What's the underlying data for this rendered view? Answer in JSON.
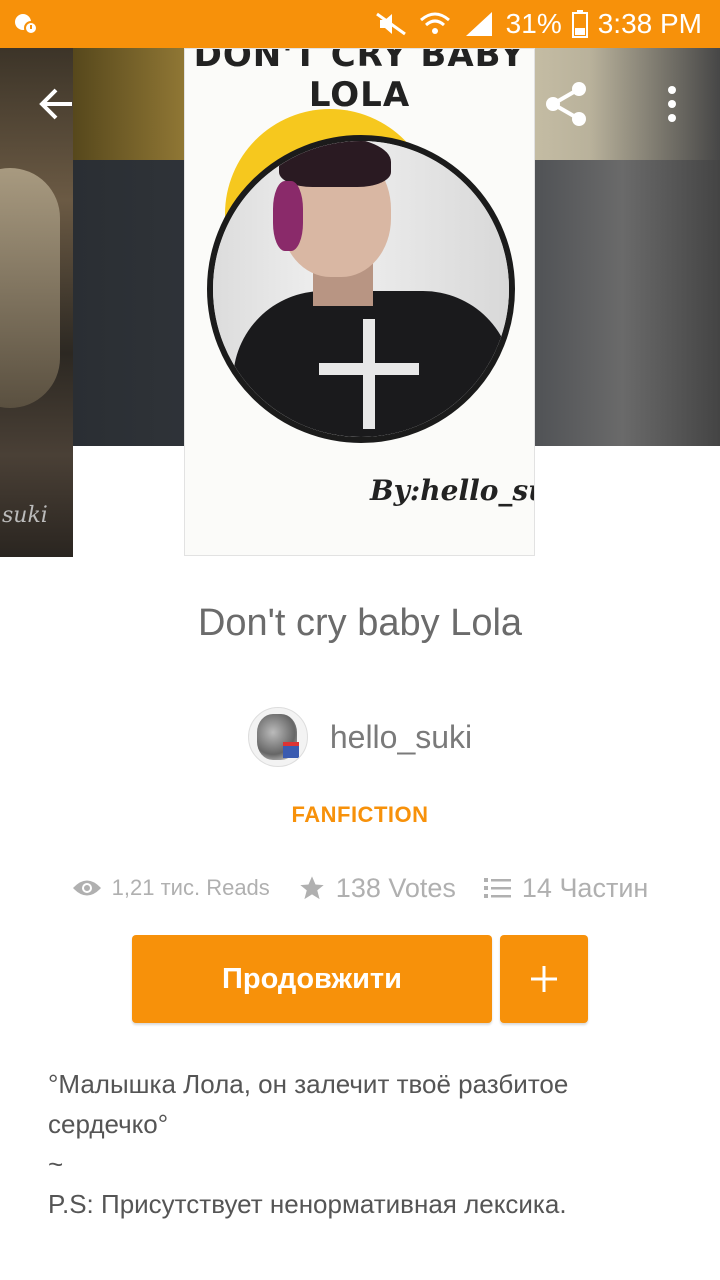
{
  "status_bar": {
    "battery_percent": "31%",
    "time": "3:38 PM"
  },
  "cover": {
    "title_text": "DON'T CRY BABY LOLA",
    "byline": "By:hello_suki"
  },
  "left_thumb": {
    "signature": "suki"
  },
  "story": {
    "title": "Don't cry baby Lola",
    "author": "hello_suki",
    "category": "FANFICTION",
    "reads": "1,21 тис. Reads",
    "votes": "138 Votes",
    "parts": "14 Частин"
  },
  "actions": {
    "continue_label": "Продовжити",
    "add_label": "+"
  },
  "description": {
    "line1": "°Малышка Лола, он залечит твоё разбитое сердечко°",
    "line2": "~",
    "line3": "P.S: Присутствует ненормативная лексика."
  },
  "colors": {
    "accent": "#f7910a",
    "status_bar": "#f7910a"
  },
  "icons": {
    "back": "arrow-left-icon",
    "share": "share-icon",
    "more": "more-vertical-icon",
    "reads": "eye-icon",
    "votes": "star-icon",
    "parts": "list-icon"
  }
}
